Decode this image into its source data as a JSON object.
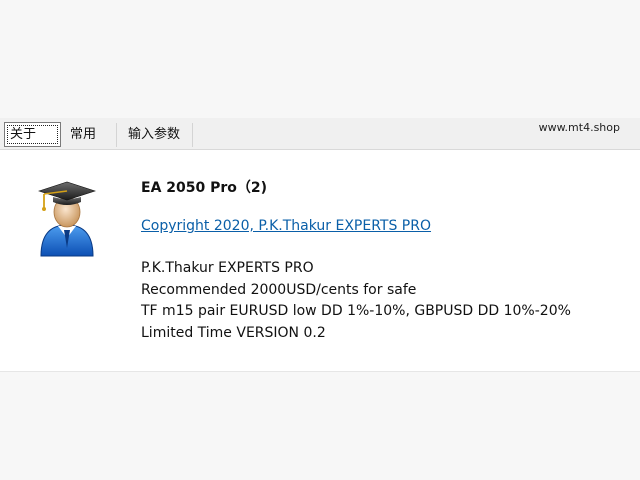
{
  "tabs": [
    {
      "label": "关于",
      "active": true
    },
    {
      "label": "常用",
      "active": false
    },
    {
      "label": "输入参数",
      "active": false
    }
  ],
  "brand": "www.mt4.shop",
  "about": {
    "icon": "graduate-user-icon",
    "title": "EA 2050 Pro（2)",
    "copyright_link": "Copyright 2020, P.K.Thakur EXPERTS PRO",
    "description_lines": [
      "P.K.Thakur EXPERTS PRO",
      "Recommended 2000USD/cents for safe",
      "TF m15 pair EURUSD low DD 1%-10%, GBPUSD DD 10%-20%",
      "Limited Time VERSION 0.2"
    ]
  },
  "colors": {
    "link": "#0a5fa8",
    "tab_strip": "#f0f0f0",
    "content_bg": "#ffffff",
    "page_bg": "#f7f7f7"
  }
}
